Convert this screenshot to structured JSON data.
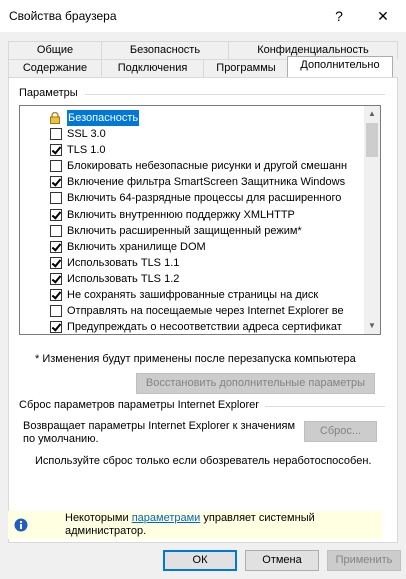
{
  "window": {
    "title": "Свойства браузера",
    "help_glyph": "?",
    "close_glyph": "✕"
  },
  "tabs": {
    "row1": [
      "Общие",
      "Безопасность",
      "Конфиденциальность"
    ],
    "row2": [
      "Содержание",
      "Подключения",
      "Программы",
      "Дополнительно"
    ],
    "active": "Дополнительно"
  },
  "settings": {
    "group_label": "Параметры",
    "category": "Безопасность",
    "items": [
      {
        "label": "SSL 3.0",
        "checked": false
      },
      {
        "label": "TLS 1.0",
        "checked": true
      },
      {
        "label": "Блокировать небезопасные рисунки и другой смешанн",
        "checked": false
      },
      {
        "label": "Включение фильтра SmartScreen Защитника Windows",
        "checked": true
      },
      {
        "label": "Включить 64-разрядные процессы для расширенного",
        "checked": false
      },
      {
        "label": "Включить внутреннюю поддержку XMLHTTP",
        "checked": true
      },
      {
        "label": "Включить расширенный защищенный режим*",
        "checked": false
      },
      {
        "label": "Включить хранилище DOM",
        "checked": true
      },
      {
        "label": "Использовать TLS 1.1",
        "checked": true
      },
      {
        "label": "Использовать TLS 1.2",
        "checked": true
      },
      {
        "label": "Не сохранять зашифрованные страницы на диск",
        "checked": true
      },
      {
        "label": "Отправлять на посещаемые через Internet Explorer ве",
        "checked": false
      },
      {
        "label": "Предупреждать о несоответствии адреса сертификат",
        "checked": true
      }
    ],
    "restart_note": "* Изменения будут применены после перезапуска компьютера",
    "restore_button": "Восстановить дополнительные параметры"
  },
  "reset": {
    "group_label": "Сброс параметров параметры Internet Explorer",
    "description": "Возвращает параметры Internet Explorer к значениям по умолчанию.",
    "button": "Сброс...",
    "hint": "Используйте сброс только если обозреватель неработоспособен."
  },
  "info": {
    "prefix": "Некоторыми ",
    "link": "параметрами",
    "suffix_line1": " управляет системный",
    "line2": "администратор."
  },
  "footer": {
    "ok": "ОК",
    "cancel": "Отмена",
    "apply": "Применить"
  }
}
